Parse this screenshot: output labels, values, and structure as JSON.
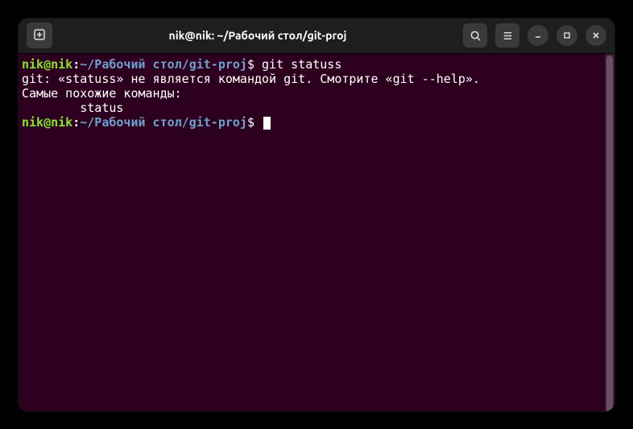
{
  "titlebar": {
    "title": "nik@nik: ~/Рабочий стол/git-proj"
  },
  "prompt": {
    "user_host": "nik@nik",
    "colon": ":",
    "path": "~/Рабочий стол/git-proj",
    "dollar": "$"
  },
  "session": {
    "command1": " git statuss",
    "output1": "git: «statuss» не является командой git. Смотрите «git --help».",
    "blank": "",
    "output2": "Самые похожие команды:",
    "output3": "        status"
  }
}
